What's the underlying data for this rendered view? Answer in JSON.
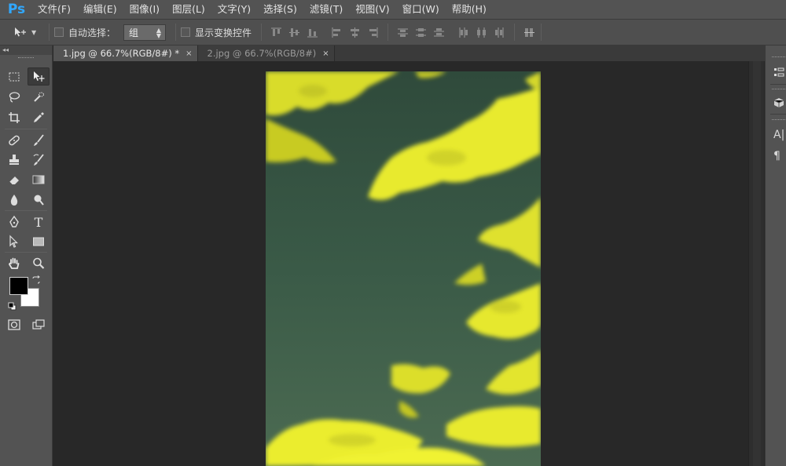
{
  "app": {
    "logo": "Ps"
  },
  "menu": [
    "文件(F)",
    "编辑(E)",
    "图像(I)",
    "图层(L)",
    "文字(Y)",
    "选择(S)",
    "滤镜(T)",
    "视图(V)",
    "窗口(W)",
    "帮助(H)"
  ],
  "options": {
    "auto_select_label": "自动选择：",
    "auto_select_value": "组",
    "show_transform_label": "显示变换控件"
  },
  "toolbar": {
    "collapse": "◂◂"
  },
  "tabs": [
    {
      "label": "1.jpg @ 66.7%(RGB/8#) *",
      "close": "×"
    },
    {
      "label": "2.jpg @ 66.7%(RGB/8#)",
      "close": "×"
    }
  ],
  "right_panel": {
    "icon_a": "A|",
    "icon_b": "¶"
  },
  "colors": {
    "accent_logo": "#31a8ff",
    "foreground": "#000000",
    "background": "#ffffff",
    "canvas_sky": "#3c5b48",
    "clouds": "#e7e82a"
  }
}
